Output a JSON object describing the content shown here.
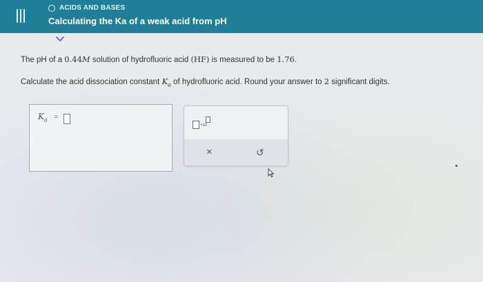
{
  "header": {
    "topic": "ACIDS AND BASES",
    "title": "Calculating the Ka of a weak acid from pH"
  },
  "problem": {
    "line1_a": "The pH of a ",
    "concentration": "0.44",
    "unit": "M",
    "line1_b": " solution of hydrofluoric acid ",
    "formula": "(HF)",
    "line1_c": " is measured to be ",
    "ph_value": "1.76",
    "line1_d": ".",
    "line2_a": "Calculate the acid dissociation constant ",
    "ka_symbol": "K",
    "ka_sub": "a",
    "line2_b": " of hydrofluoric acid. Round your answer to ",
    "sig_figs": "2",
    "line2_c": " significant digits."
  },
  "answer": {
    "label": "K",
    "label_sub": "a",
    "equals": "=",
    "value": ""
  },
  "tools": {
    "sci_notation_label": "×10",
    "clear_label": "×",
    "undo_label": "↺"
  }
}
